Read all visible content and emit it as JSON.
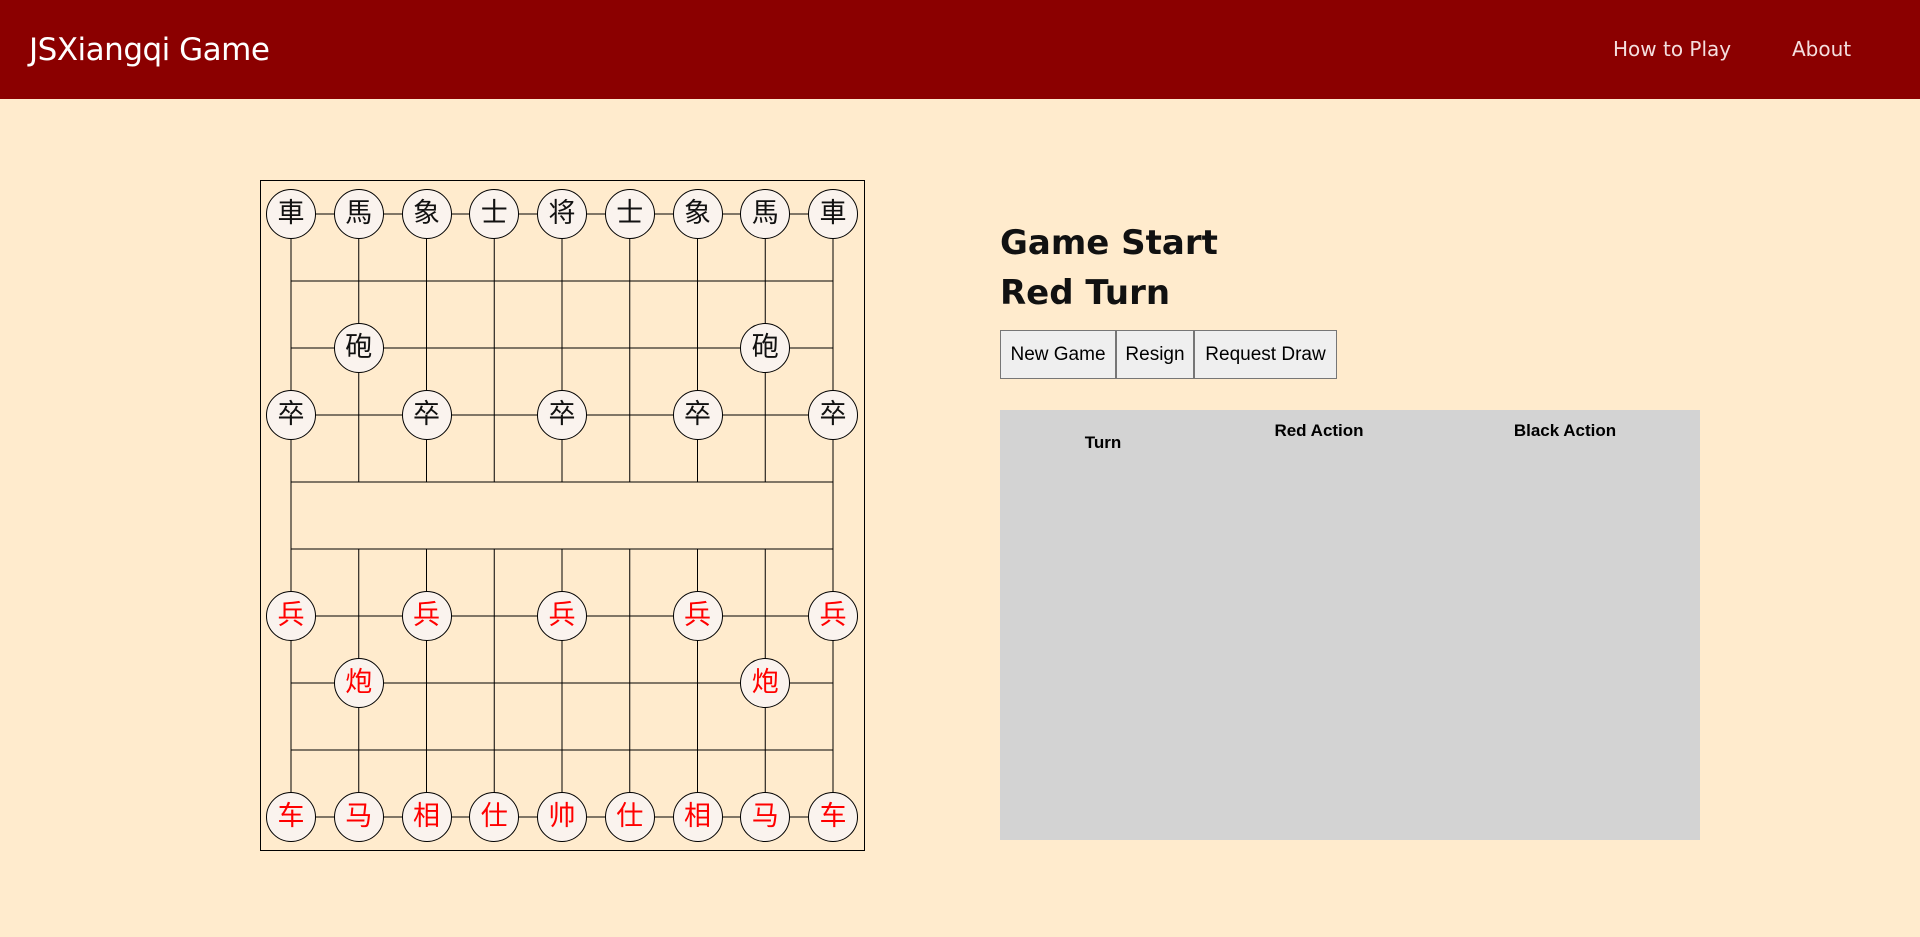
{
  "navbar": {
    "brand": "JSXiangqi Game",
    "links": [
      "How to Play",
      "About"
    ]
  },
  "colors": {
    "navbar_bg": "#8b0000",
    "page_bg": "#ffebcd",
    "red_piece": "#ff0000",
    "black_piece": "#111111",
    "piece_bg": "#faf3ee",
    "history_bg": "#d3d3d3"
  },
  "status": {
    "game": "Game Start",
    "turn": "Red Turn"
  },
  "buttons": {
    "new_game": "New Game",
    "resign": "Resign",
    "request_draw": "Request Draw"
  },
  "history": {
    "headers": {
      "turn": "Turn",
      "red_action": "Red Action",
      "black_action": "Black Action"
    },
    "rows": []
  },
  "board": {
    "files": 9,
    "ranks": 10,
    "pieces": [
      {
        "side": "black",
        "char": "車",
        "file": 0,
        "rank": 0
      },
      {
        "side": "black",
        "char": "馬",
        "file": 1,
        "rank": 0
      },
      {
        "side": "black",
        "char": "象",
        "file": 2,
        "rank": 0
      },
      {
        "side": "black",
        "char": "士",
        "file": 3,
        "rank": 0
      },
      {
        "side": "black",
        "char": "将",
        "file": 4,
        "rank": 0
      },
      {
        "side": "black",
        "char": "士",
        "file": 5,
        "rank": 0
      },
      {
        "side": "black",
        "char": "象",
        "file": 6,
        "rank": 0
      },
      {
        "side": "black",
        "char": "馬",
        "file": 7,
        "rank": 0
      },
      {
        "side": "black",
        "char": "車",
        "file": 8,
        "rank": 0
      },
      {
        "side": "black",
        "char": "砲",
        "file": 1,
        "rank": 2
      },
      {
        "side": "black",
        "char": "砲",
        "file": 7,
        "rank": 2
      },
      {
        "side": "black",
        "char": "卒",
        "file": 0,
        "rank": 3
      },
      {
        "side": "black",
        "char": "卒",
        "file": 2,
        "rank": 3
      },
      {
        "side": "black",
        "char": "卒",
        "file": 4,
        "rank": 3
      },
      {
        "side": "black",
        "char": "卒",
        "file": 6,
        "rank": 3
      },
      {
        "side": "black",
        "char": "卒",
        "file": 8,
        "rank": 3
      },
      {
        "side": "red",
        "char": "兵",
        "file": 0,
        "rank": 6
      },
      {
        "side": "red",
        "char": "兵",
        "file": 2,
        "rank": 6
      },
      {
        "side": "red",
        "char": "兵",
        "file": 4,
        "rank": 6
      },
      {
        "side": "red",
        "char": "兵",
        "file": 6,
        "rank": 6
      },
      {
        "side": "red",
        "char": "兵",
        "file": 8,
        "rank": 6
      },
      {
        "side": "red",
        "char": "炮",
        "file": 1,
        "rank": 7
      },
      {
        "side": "red",
        "char": "炮",
        "file": 7,
        "rank": 7
      },
      {
        "side": "red",
        "char": "车",
        "file": 0,
        "rank": 9
      },
      {
        "side": "red",
        "char": "马",
        "file": 1,
        "rank": 9
      },
      {
        "side": "red",
        "char": "相",
        "file": 2,
        "rank": 9
      },
      {
        "side": "red",
        "char": "仕",
        "file": 3,
        "rank": 9
      },
      {
        "side": "red",
        "char": "帅",
        "file": 4,
        "rank": 9
      },
      {
        "side": "red",
        "char": "仕",
        "file": 5,
        "rank": 9
      },
      {
        "side": "red",
        "char": "相",
        "file": 6,
        "rank": 9
      },
      {
        "side": "red",
        "char": "马",
        "file": 7,
        "rank": 9
      },
      {
        "side": "red",
        "char": "车",
        "file": 8,
        "rank": 9
      }
    ]
  }
}
